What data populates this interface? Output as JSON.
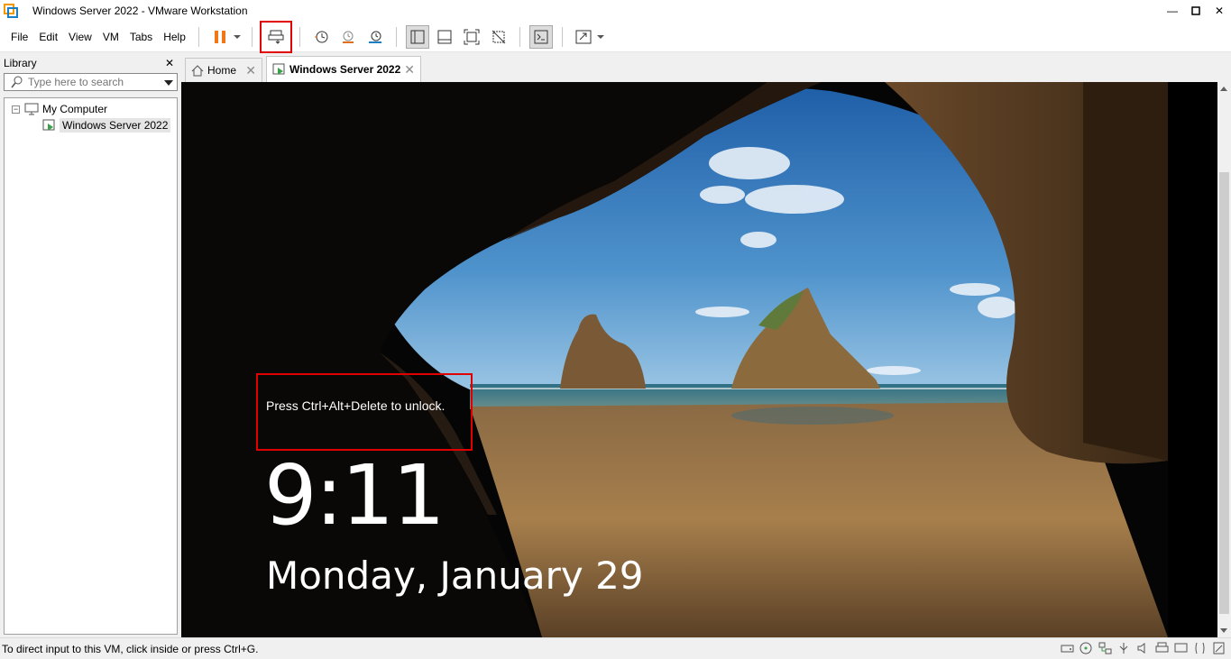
{
  "window": {
    "title": "Windows Server 2022 - VMware Workstation",
    "minimize": "—",
    "maximize": "□",
    "close": "✕"
  },
  "menu": [
    "File",
    "Edit",
    "View",
    "VM",
    "Tabs",
    "Help"
  ],
  "toolbar": {
    "icons": [
      "pause-icon",
      "send-ctrl-alt-del-icon",
      "snapshot-icon",
      "revert-snapshot-icon",
      "snapshot-manager-icon",
      "show-library-icon",
      "thumbnail-bar-icon",
      "full-screen-icon",
      "unity-icon",
      "console-view-icon",
      "stretch-icon"
    ],
    "highlight_color": "#e00000",
    "pause_color": "#f07818"
  },
  "library": {
    "title": "Library",
    "close": "✕",
    "search_placeholder": "Type here to search",
    "tree": {
      "root": "My Computer",
      "expander": "−",
      "vm": "Windows Server 2022"
    }
  },
  "tabs": [
    {
      "label": "Home",
      "close": "✕",
      "active": false
    },
    {
      "label": "Windows Server 2022",
      "close": "✕",
      "active": true
    }
  ],
  "lockscreen": {
    "unlock_prompt": "Press Ctrl+Alt+Delete to unlock.",
    "time": "9:11",
    "date": "Monday, January 29"
  },
  "status": {
    "text": "To direct input to this VM, click inside or press Ctrl+G.",
    "icons": [
      "hard-disk-icon",
      "cd-dvd-icon",
      "network-icon",
      "usb-icon",
      "sound-icon",
      "printer-icon",
      "display-icon",
      "message-icon"
    ]
  }
}
